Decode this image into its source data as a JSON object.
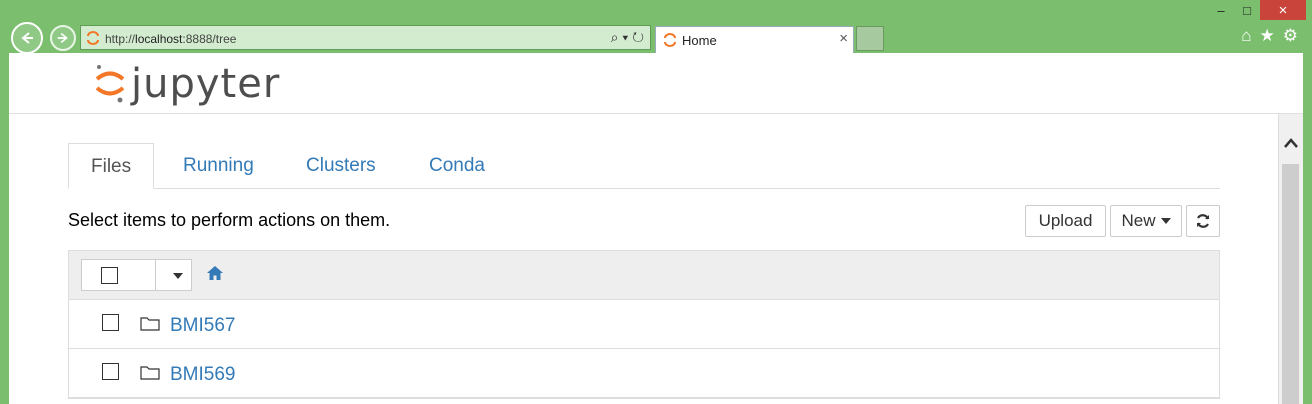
{
  "browser": {
    "address_url_prefix": "http://",
    "address_url_host": "localhost",
    "address_url_suffix": ":8888/tree",
    "tab_title": "Home",
    "tab_close": "×",
    "window_min": "–",
    "window_max": "□",
    "window_close": "×"
  },
  "app": {
    "logo_text": "jupyter",
    "brand_orange": "#f37726"
  },
  "tabs": [
    {
      "label": "Files",
      "active": true
    },
    {
      "label": "Running",
      "active": false
    },
    {
      "label": "Clusters",
      "active": false
    },
    {
      "label": "Conda",
      "active": false
    }
  ],
  "toolbar": {
    "hint": "Select items to perform actions on them.",
    "upload_label": "Upload",
    "new_label": "New"
  },
  "files": [
    {
      "name": "BMI567",
      "type": "folder"
    },
    {
      "name": "BMI569",
      "type": "folder"
    }
  ],
  "colors": {
    "link": "#337ab7",
    "chrome_green": "#7bbf6e"
  }
}
